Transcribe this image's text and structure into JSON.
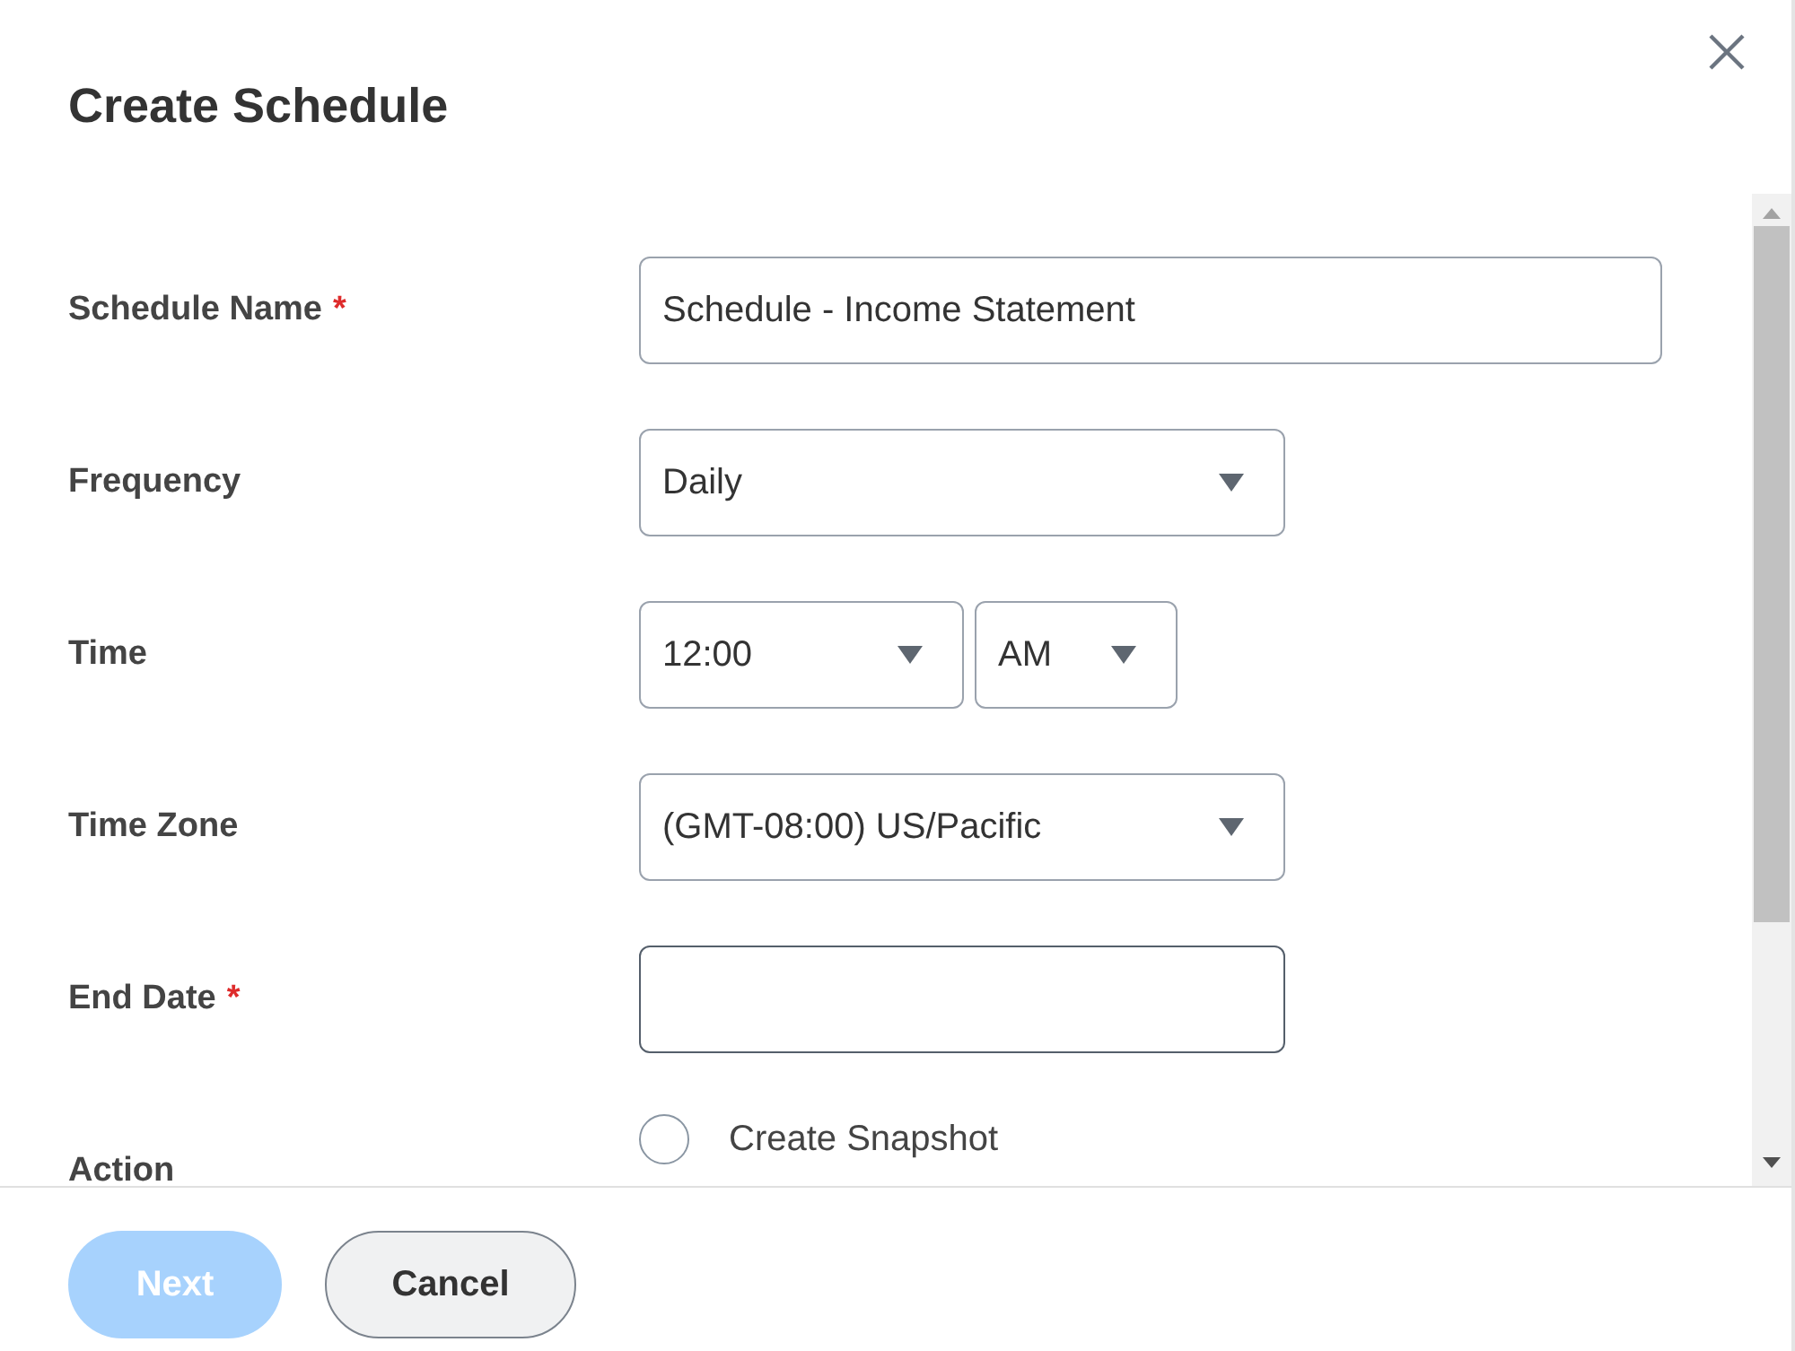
{
  "dialog": {
    "title": "Create Schedule"
  },
  "fields": [
    {
      "kind": "text",
      "label": "Schedule Name",
      "required_mark": "*",
      "value": "Schedule - Income Statement"
    },
    {
      "kind": "select",
      "label": "Frequency",
      "value": "Daily"
    },
    {
      "kind": "time",
      "label": "Time",
      "value": "12:00",
      "period": "AM"
    },
    {
      "kind": "select",
      "label": "Time Zone",
      "value": "(GMT-08:00) US/Pacific"
    },
    {
      "kind": "date",
      "label": "End Date",
      "required_mark": "*"
    },
    {
      "kind": "radio",
      "label": "Action",
      "options": [
        {
          "label": "Create Snapshot",
          "selected": false
        }
      ]
    }
  ],
  "buttons": [
    {
      "label": "Next",
      "disabled": true
    },
    {
      "label": "Cancel",
      "disabled": false
    }
  ]
}
